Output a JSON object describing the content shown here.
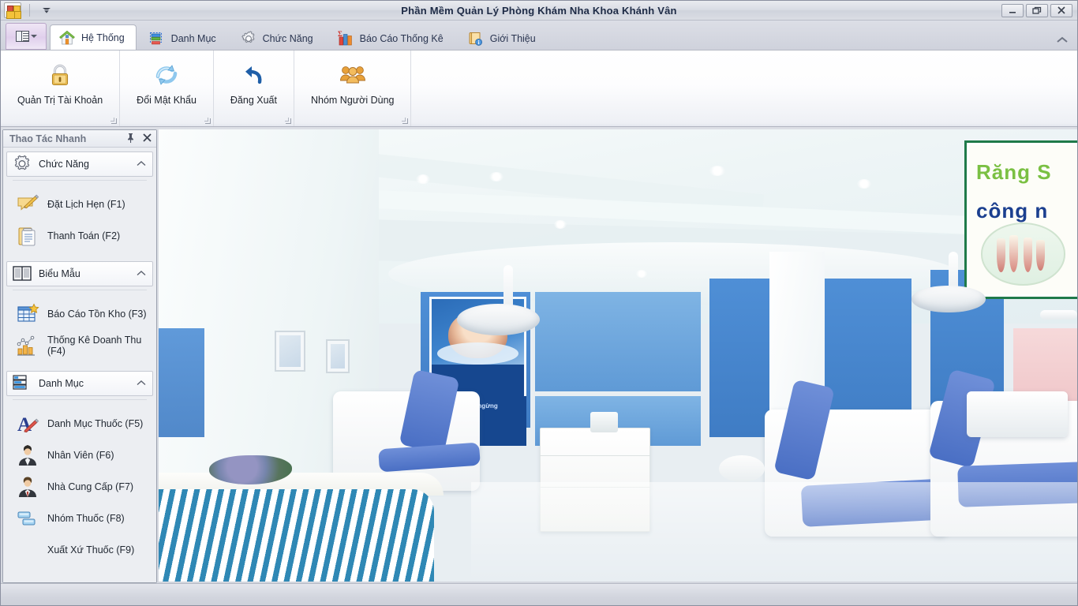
{
  "window": {
    "title": "Phần Mềm Quản Lý Phòng Khám Nha Khoa Khánh Vân",
    "minimize_label": "—",
    "restore_label": "❐",
    "close_label": "✕"
  },
  "quick_access": {
    "app_icon_name": "app-logo-icon",
    "customize_label": "▼"
  },
  "tabs": [
    {
      "label": "Hệ Thống",
      "icon": "home-icon",
      "active": true
    },
    {
      "label": "Danh Mục",
      "icon": "list-icon",
      "active": false
    },
    {
      "label": "Chức Năng",
      "icon": "gear-icon",
      "active": false
    },
    {
      "label": "Báo Cáo Thống Kê",
      "icon": "bar-chart-icon",
      "active": false
    },
    {
      "label": "Giới Thiệu",
      "icon": "book-info-icon",
      "active": false
    }
  ],
  "ribbon": {
    "collapse_label": "︿",
    "groups": [
      {
        "buttons": [
          {
            "label": "Quản Trị Tài Khoản",
            "icon": "lock-icon"
          }
        ]
      },
      {
        "buttons": [
          {
            "label": "Đổi Mật Khẩu",
            "icon": "refresh-icon"
          }
        ]
      },
      {
        "buttons": [
          {
            "label": "Đăng Xuất",
            "icon": "logout-arrow-icon"
          }
        ]
      },
      {
        "buttons": [
          {
            "label": "Nhóm Người Dùng",
            "icon": "users-group-icon"
          }
        ]
      }
    ]
  },
  "sidebar": {
    "title": "Thao Tác Nhanh",
    "pin_label": "⚲",
    "close_label": "✕",
    "groups": [
      {
        "label": "Chức Năng",
        "icon": "gear-icon",
        "collapse_label": "︿",
        "items": [
          {
            "label": "Đặt Lịch Hẹn  (F1)",
            "icon": "note-pencil-icon"
          },
          {
            "label": "Thanh Toán (F2)",
            "icon": "clipboard-icon"
          }
        ]
      },
      {
        "label": "Biểu Mẫu",
        "icon": "book-open-icon",
        "collapse_label": "︿",
        "items": [
          {
            "label": "Báo Cáo Tồn Kho (F3)",
            "icon": "table-star-icon"
          },
          {
            "label": "Thống Kê Doanh Thu (F4)",
            "icon": "chart-line-icon"
          }
        ]
      },
      {
        "label": "Danh Mục",
        "icon": "list-icon",
        "collapse_label": "︿",
        "items": [
          {
            "label": "Danh Mục Thuốc (F5)",
            "icon": "font-pencil-icon"
          },
          {
            "label": "Nhân Viên (F6)",
            "icon": "woman-user-icon"
          },
          {
            "label": "Nhà Cung Cấp (F7)",
            "icon": "man-user-icon"
          },
          {
            "label": "Nhóm Thuốc (F8)",
            "icon": "stacked-boxes-icon"
          },
          {
            "label": "Xuất Xứ Thuốc (F9)",
            "icon": "none"
          }
        ]
      }
    ]
  },
  "main": {
    "content_name": "dental-clinic-photo",
    "poster_headline_1": "Răng S",
    "poster_headline_2": "công n",
    "wall_banner": "nỗ lực không ngừng"
  },
  "colors": {
    "accent_blue": "#4f8fd6",
    "title_text": "#1d2a45",
    "ribbon_bg": "#ffffff",
    "tabstrip_bg": "#d6d9e1",
    "sidebar_bg": "#eceef2"
  }
}
